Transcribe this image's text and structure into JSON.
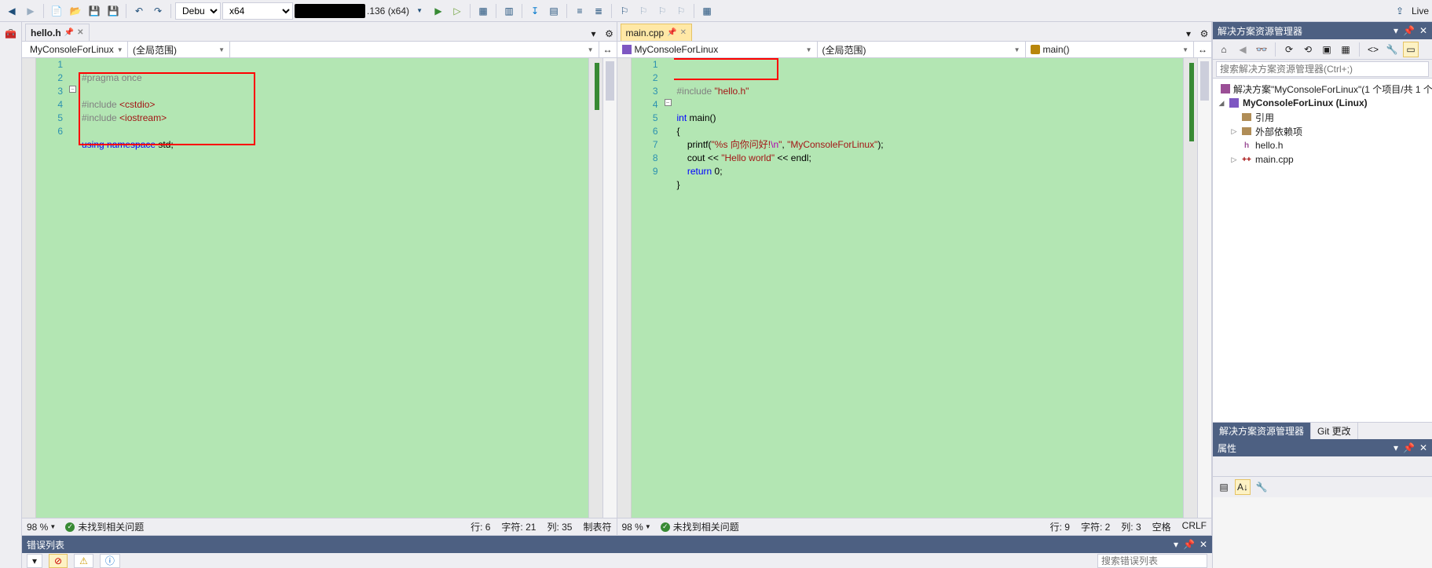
{
  "toolbar": {
    "config": "Debug",
    "platform": "x64",
    "target_suffix": ".136 (x64)",
    "live": "Live"
  },
  "left_pane": {
    "tab_label": "hello.h",
    "nav_project": "MyConsoleForLinux",
    "nav_scope": "(全局范围)",
    "lines": {
      "1": "1",
      "2": "2",
      "3": "3",
      "4": "4",
      "5": "5",
      "6": "6"
    },
    "code": {
      "l1_pp": "#pragma once",
      "l3_inc": "#include ",
      "l3_hdr": "<cstdio>",
      "l4_inc": "#include ",
      "l4_hdr": "<iostream>",
      "l6_kw1": "using ",
      "l6_kw2": "namespace ",
      "l6_id": "std",
      "l6_semi": ";"
    },
    "status": {
      "zoom": "98 %",
      "issues": "未找到相关问题",
      "line": "行: 6",
      "col": "字符: 21",
      "pos": "列: 35",
      "mode": "制表符"
    }
  },
  "right_pane": {
    "tab_label": "main.cpp",
    "nav_project": "MyConsoleForLinux",
    "nav_scope": "(全局范围)",
    "nav_func": "main()",
    "lines": {
      "1": "1",
      "2": "2",
      "3": "3",
      "4": "4",
      "5": "5",
      "6": "6",
      "7": "7",
      "8": "8",
      "9": "9"
    },
    "code": {
      "l2_inc": "#include ",
      "l2_hdr": "\"hello.h\"",
      "l4_kw1": "int ",
      "l4_id": "main()",
      "l5_brace": "{",
      "l6_fn": "    printf(",
      "l6_s1": "\"%s 向你问好!",
      "l6_esc": "\\n",
      "l6_s1b": "\"",
      "l6_comma": ", ",
      "l6_s2": "\"MyConsoleForLinux\"",
      "l6_end": ");",
      "l7_id1": "    cout ",
      "l7_op1": "<< ",
      "l7_str": "\"Hello world\"",
      "l7_op2": " << ",
      "l7_id2": "endl",
      "l7_semi": ";",
      "l8_kw": "    return ",
      "l8_num": "0",
      "l8_semi": ";",
      "l9_brace": "}"
    },
    "status": {
      "zoom": "98 %",
      "issues": "未找到相关问题",
      "line": "行: 9",
      "col": "字符: 2",
      "pos": "列: 3",
      "ws": "空格",
      "le": "CRLF"
    }
  },
  "bottom": {
    "title": "错误列表",
    "search_ph": "搜索错误列表"
  },
  "se": {
    "title": "解决方案资源管理器",
    "search_ph": "搜索解决方案资源管理器(Ctrl+;)",
    "sln": "解决方案\"MyConsoleForLinux\"(1 个项目/共 1 个)",
    "proj": "MyConsoleForLinux (Linux)",
    "ref": "引用",
    "ext": "外部依赖项",
    "h": "hello.h",
    "cpp": "main.cpp",
    "tabs": {
      "a": "解决方案资源管理器",
      "b": "Git 更改"
    }
  },
  "props": {
    "title": "属性"
  }
}
